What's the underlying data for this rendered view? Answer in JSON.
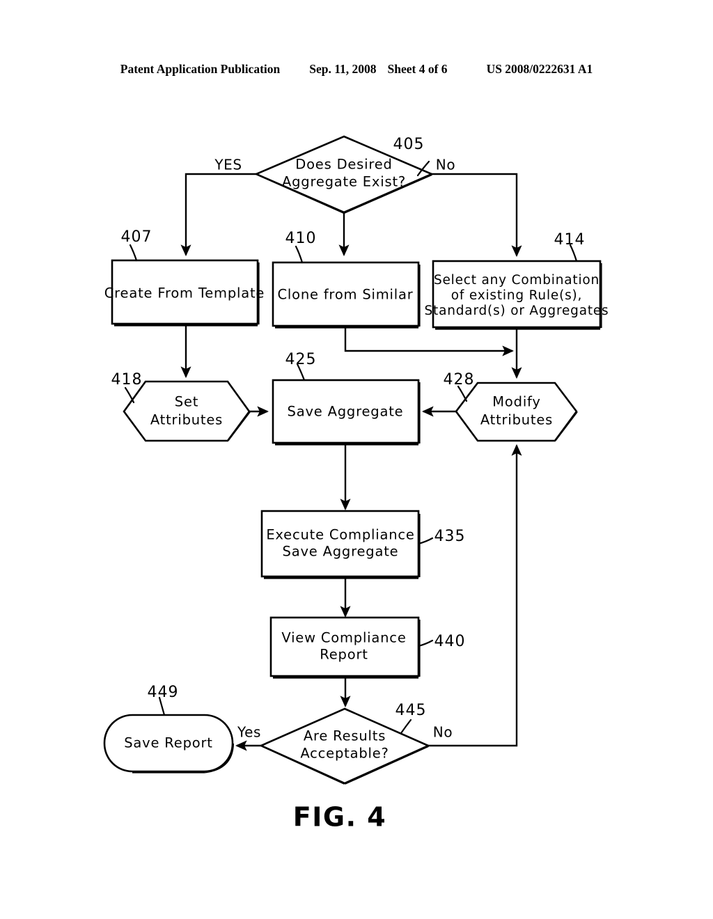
{
  "header": {
    "publication": "Patent Application Publication",
    "date": "Sep. 11, 2008",
    "sheet": "Sheet 4 of 6",
    "patent_number": "US 2008/0222631 A1"
  },
  "figure": {
    "caption": "FIG. 4"
  },
  "nodes": {
    "n405": {
      "ref": "405",
      "shape": "diamond",
      "text_line1": "Does Desired",
      "text_line2": "Aggregate Exist?"
    },
    "n407": {
      "ref": "407",
      "shape": "rect",
      "text_line1": "Create From Template"
    },
    "n410": {
      "ref": "410",
      "shape": "rect",
      "text_line1": "Clone from Similar"
    },
    "n414": {
      "ref": "414",
      "shape": "rect",
      "text_line1": "Select any Combination",
      "text_line2": "of existing Rule(s),",
      "text_line3": "Standard(s) or Aggregates"
    },
    "n418": {
      "ref": "418",
      "shape": "hexagon",
      "text_line1": "Set",
      "text_line2": "Attributes"
    },
    "n425": {
      "ref": "425",
      "shape": "rect",
      "text_line1": "Save Aggregate"
    },
    "n428": {
      "ref": "428",
      "shape": "hexagon",
      "text_line1": "Modify",
      "text_line2": "Attributes"
    },
    "n435": {
      "ref": "435",
      "shape": "rect",
      "text_line1": "Execute Compliance",
      "text_line2": "Save Aggregate"
    },
    "n440": {
      "ref": "440",
      "shape": "rect",
      "text_line1": "View Compliance",
      "text_line2": "Report"
    },
    "n445": {
      "ref": "445",
      "shape": "diamond",
      "text_line1": "Are Results",
      "text_line2": "Acceptable?"
    },
    "n449": {
      "ref": "449",
      "shape": "stadium",
      "text_line1": "Save Report"
    }
  },
  "branch_labels": {
    "d405_yes": "YES",
    "d405_no": "No",
    "d445_yes": "Yes",
    "d445_no": "No"
  },
  "colors": {
    "ink": "#000000",
    "paper": "#ffffff"
  }
}
